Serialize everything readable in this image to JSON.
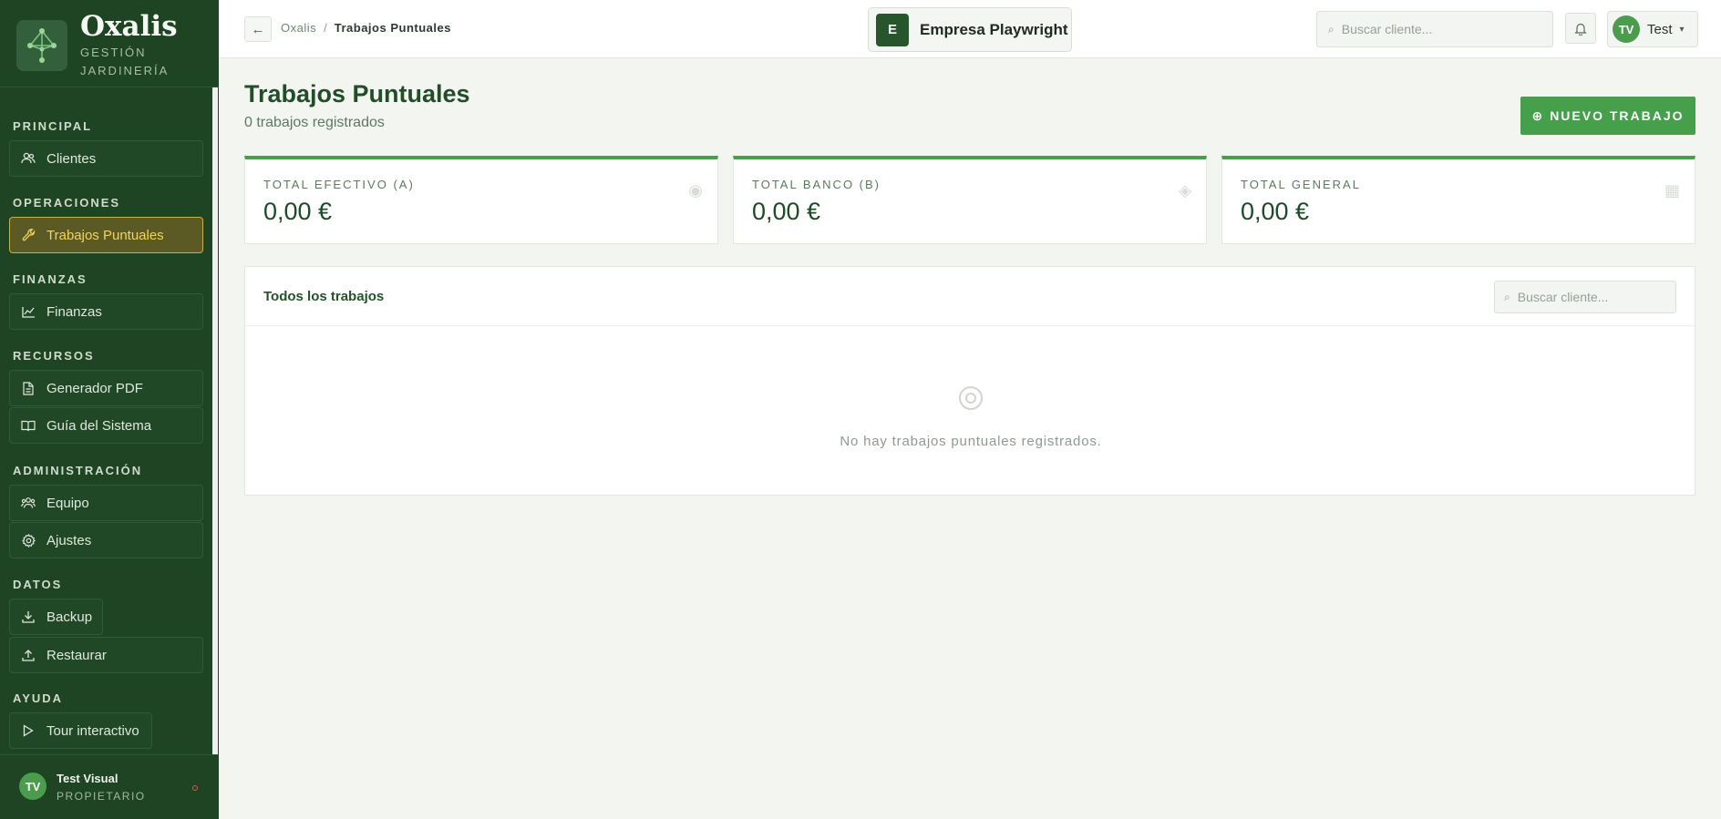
{
  "brand": {
    "name": "Oxalis",
    "subtitle_line1": "GESTIÓN",
    "subtitle_line2": "JARDINERÍA"
  },
  "sidebar": {
    "sections": [
      {
        "title": "PRINCIPAL"
      },
      {
        "title": "OPERACIONES"
      },
      {
        "title": "FINANZAS"
      },
      {
        "title": "RECURSOS"
      },
      {
        "title": "ADMINISTRACIÓN"
      },
      {
        "title": "DATOS"
      },
      {
        "title": "AYUDA"
      }
    ],
    "items": [
      {
        "label": "Clientes",
        "icon": "users-icon"
      },
      {
        "label": "Trabajos Puntuales",
        "icon": "wrench-icon",
        "active": true
      },
      {
        "label": "Finanzas",
        "icon": "chart-line-icon"
      },
      {
        "label": "Generador PDF",
        "icon": "document-icon"
      },
      {
        "label": "Guía del Sistema",
        "icon": "book-icon"
      },
      {
        "label": "Equipo",
        "icon": "team-icon"
      },
      {
        "label": "Ajustes",
        "icon": "gear-icon"
      },
      {
        "label": "Backup",
        "icon": "download-icon"
      },
      {
        "label": "Restaurar",
        "icon": "upload-icon"
      },
      {
        "label": "Tour interactivo",
        "icon": "play-icon"
      }
    ],
    "footer": {
      "initials": "TV",
      "name": "Test Visual",
      "role": "PROPIETARIO"
    }
  },
  "header": {
    "back_label": "←",
    "breadcrumb_root": "Oxalis",
    "breadcrumb_sep": "/",
    "breadcrumb_current": "Trabajos Puntuales",
    "company_initial": "E",
    "company_name": "Empresa Playwright",
    "search_glyph": "⌕",
    "search_placeholder": "Buscar cliente...",
    "user_initials": "TV",
    "user_name": "Test",
    "caret": "▾"
  },
  "main": {
    "title": "Trabajos Puntuales",
    "subtitle": "0 trabajos registrados",
    "new_glyph": "⊕",
    "new_button": "NUEVO TRABAJO",
    "cards": [
      {
        "label": "TOTAL EFECTIVO (A)",
        "value": "0,00 €",
        "glyph": "◉"
      },
      {
        "label": "TOTAL BANCO (B)",
        "value": "0,00 €",
        "glyph": "◈"
      },
      {
        "label": "TOTAL GENERAL",
        "value": "0,00 €",
        "glyph": "▦"
      }
    ],
    "panel": {
      "title": "Todos los trabajos",
      "search_placeholder": "Buscar cliente...",
      "empty_text": "No hay trabajos puntuales registrados."
    }
  },
  "colors": {
    "sidebar_bg": "#1e4423",
    "accent": "#46a04b",
    "active_text": "#f3d35a",
    "active_border": "#c8b34a"
  }
}
